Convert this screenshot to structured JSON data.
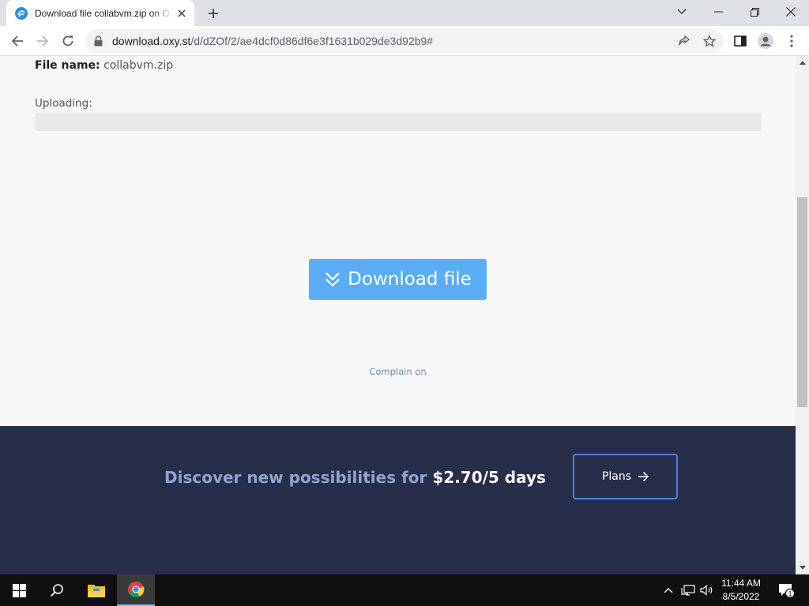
{
  "browser": {
    "tab": {
      "title": "Download file collabvm.zip on Oxy.st"
    },
    "address": {
      "host": "download.oxy.st",
      "path": "/d/dZOf/2/ae4dcf0d86df6e3f1631b029de3d92b9#"
    }
  },
  "page": {
    "file_name_label": "File name:",
    "file_name_value": "collabvm.zip",
    "uploading_label": "Uploading:",
    "upload_progress": 0,
    "download_button_label": "Download file",
    "complain_link": "Complain on",
    "promo_text": "Discover new possibilities for",
    "promo_price": "$2.70/5 days",
    "plans_button_label": "Plans"
  },
  "taskbar": {
    "time": "11:44 AM",
    "date": "8/5/2022",
    "notification_count": "1"
  },
  "colors": {
    "accent_button": "#5aadf5",
    "footer_band": "#272e49",
    "plans_border": "#4f7fe0"
  }
}
